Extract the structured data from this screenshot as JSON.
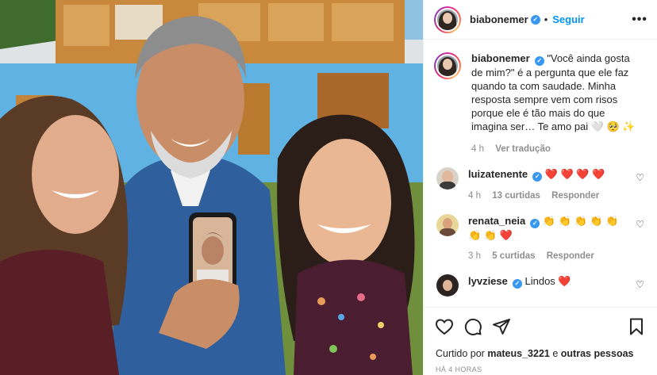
{
  "post": {
    "username": "biabonemer",
    "follow_label": "Seguir",
    "more_label": "•••",
    "caption": "\"Você ainda gosta de mim?\" é a pergunta que ele faz quando ta com saudade. Minha resposta sempre vem com risos porque ele é tão mais do que imagina ser… Te amo pai 🤍 🥺 ✨",
    "caption_time": "4 h",
    "translate_label": "Ver tradução",
    "verified_icon": "verified-badge-icon",
    "accent_color": "#0095f6"
  },
  "comments": [
    {
      "username": "luizatenente",
      "text": "❤️ ❤️ ❤️ ❤️",
      "time": "4 h",
      "likes": "13 curtidas",
      "reply_label": "Responder"
    },
    {
      "username": "renata_neia",
      "text": "👏 👏 👏 👏 👏 👏 👏 ❤️",
      "time": "3 h",
      "likes": "5 curtidas",
      "reply_label": "Responder"
    },
    {
      "username": "lyvziese",
      "text": "Lindos ❤️"
    }
  ],
  "footer": {
    "liked_prefix": "Curtido por",
    "liked_user": "mateus_3221",
    "liked_and": "e",
    "liked_others": "outras pessoas",
    "timestamp": "HÁ 4 HORAS"
  },
  "icons": {
    "like": "heart-outline-icon",
    "comment": "comment-bubble-icon",
    "share": "paper-plane-icon",
    "save": "bookmark-icon"
  }
}
